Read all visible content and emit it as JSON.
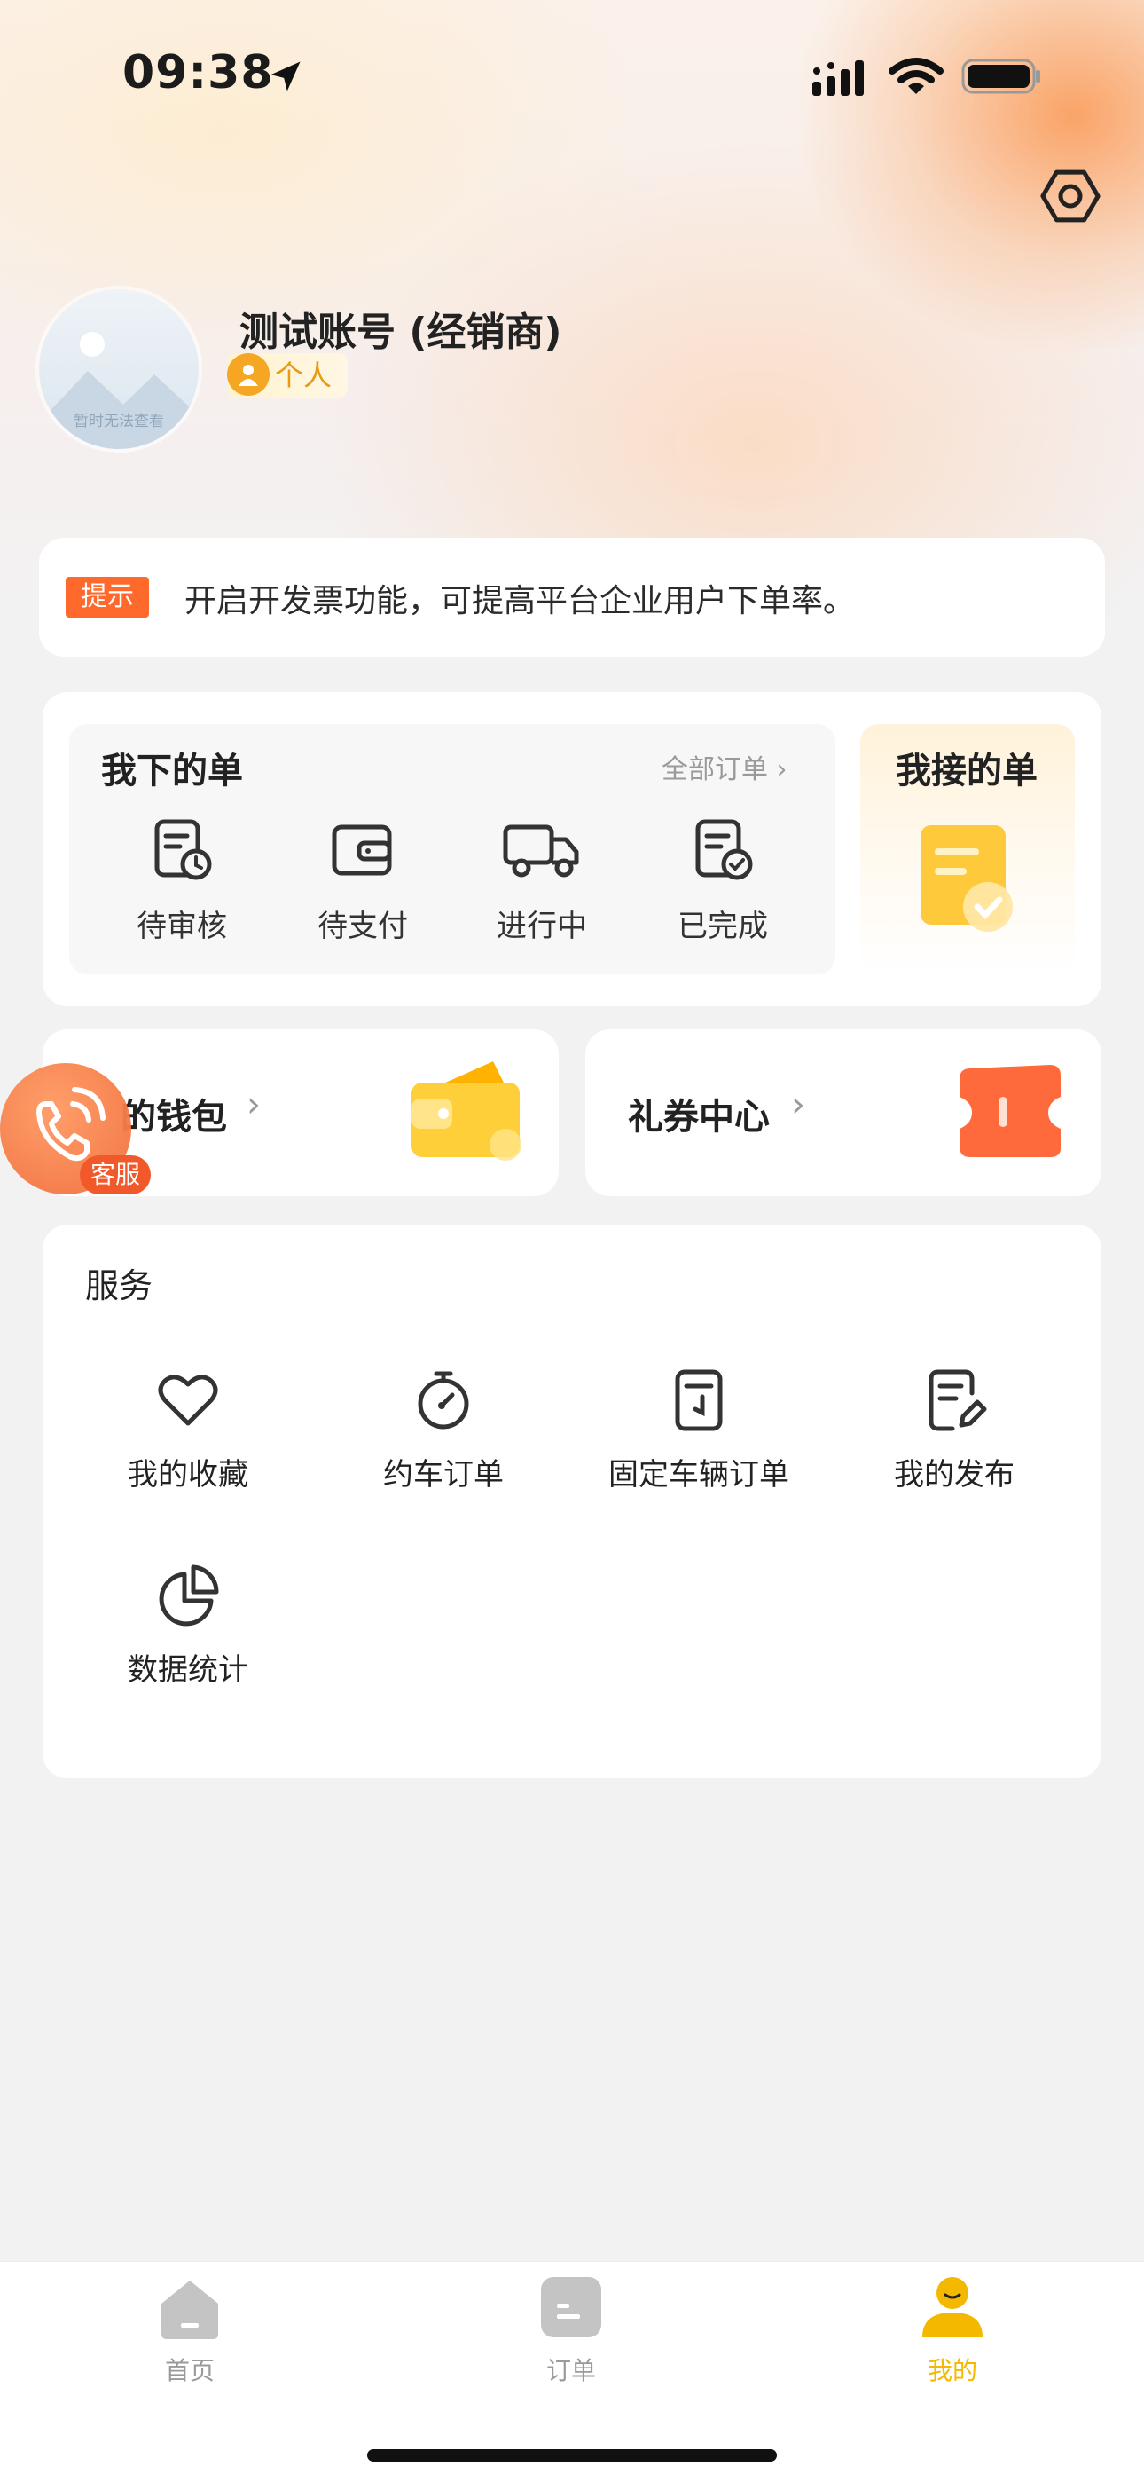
{
  "status_bar": {
    "time": "09:38"
  },
  "profile": {
    "name": "测试账号 (经销商)",
    "role": "个人",
    "avatar_placeholder": "暂时无法查看"
  },
  "tip": {
    "tag": "提示",
    "text": "开启开发票功能，可提高平台企业用户下单率。"
  },
  "orders": {
    "my_orders_title": "我下的单",
    "all_orders_link": "全部订单",
    "items": [
      {
        "label": "待审核",
        "icon": "review-doc-icon"
      },
      {
        "label": "待支付",
        "icon": "wallet-icon"
      },
      {
        "label": "进行中",
        "icon": "truck-icon"
      },
      {
        "label": "已完成",
        "icon": "done-doc-icon"
      }
    ],
    "received_title": "我接的单"
  },
  "wallet": {
    "label": "的钱包"
  },
  "coupons": {
    "label": "礼券中心"
  },
  "services": {
    "title": "服务",
    "items": [
      {
        "label": "我的收藏",
        "icon": "heart-icon"
      },
      {
        "label": "约车订单",
        "icon": "stopwatch-icon"
      },
      {
        "label": "固定车辆订单",
        "icon": "document-icon"
      },
      {
        "label": "我的发布",
        "icon": "edit-doc-icon"
      },
      {
        "label": "数据统计",
        "icon": "pie-chart-icon"
      }
    ]
  },
  "customer_service": {
    "label": "客服"
  },
  "tabbar": {
    "items": [
      {
        "label": "首页",
        "icon": "home-icon",
        "active": false
      },
      {
        "label": "订单",
        "icon": "order-icon",
        "active": false
      },
      {
        "label": "我的",
        "icon": "profile-icon",
        "active": true
      }
    ],
    "active_color": "#f5b800",
    "inactive_color": "#9a9a9a"
  },
  "colors": {
    "accent_orange": "#ff6a2c",
    "accent_yellow": "#f5b800"
  }
}
